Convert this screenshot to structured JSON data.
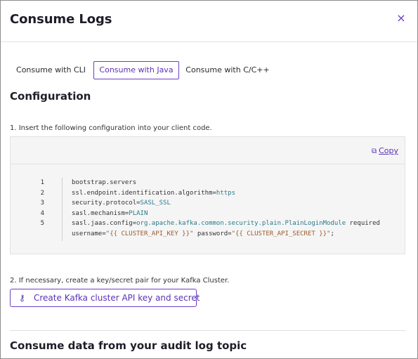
{
  "dialog": {
    "title": "Consume Logs",
    "close_icon": "×"
  },
  "tabs": [
    {
      "label": "Consume with CLI",
      "active": false
    },
    {
      "label": "Consume with Java",
      "active": true
    },
    {
      "label": "Consume with C/C++",
      "active": false
    }
  ],
  "configuration": {
    "heading": "Configuration",
    "step1": "1. Insert the following configuration into your client code.",
    "copy_label": "Copy",
    "copy_icon": "⧉",
    "code_lines": [
      {
        "num": "1",
        "parts": [
          {
            "t": "bootstrap.servers",
            "c": "k"
          }
        ]
      },
      {
        "num": "2",
        "parts": [
          {
            "t": "ssl.endpoint.identification.algorithm=",
            "c": "k"
          },
          {
            "t": "https",
            "c": "v"
          }
        ]
      },
      {
        "num": "3",
        "parts": [
          {
            "t": "security.protocol=",
            "c": "k"
          },
          {
            "t": "SASL_SSL",
            "c": "v"
          }
        ]
      },
      {
        "num": "4",
        "parts": [
          {
            "t": "sasl.mechanism=",
            "c": "k"
          },
          {
            "t": "PLAIN",
            "c": "v"
          }
        ]
      },
      {
        "num": "5",
        "parts": [
          {
            "t": "sasl.jaas.config=",
            "c": "k"
          },
          {
            "t": "org.apache.kafka.common.security.plain.PlainLoginModule",
            "c": "v"
          },
          {
            "t": " required",
            "c": "k"
          }
        ]
      },
      {
        "num": "",
        "parts": [
          {
            "t": "username=",
            "c": "k"
          },
          {
            "t": "\"{{ CLUSTER_API_KEY }}\"",
            "c": "s"
          },
          {
            "t": " password=",
            "c": "k"
          },
          {
            "t": "\"{{ CLUSTER_API_SECRET }}\"",
            "c": "s"
          },
          {
            "t": ";",
            "c": "k"
          }
        ]
      }
    ],
    "step2": "2. If necessary, create a key/secret pair for your Kafka Cluster.",
    "api_button_label": "Create Kafka cluster API key and secret",
    "api_button_icon": "⚷"
  },
  "consume_section": {
    "heading": "Consume data from your audit log topic"
  }
}
